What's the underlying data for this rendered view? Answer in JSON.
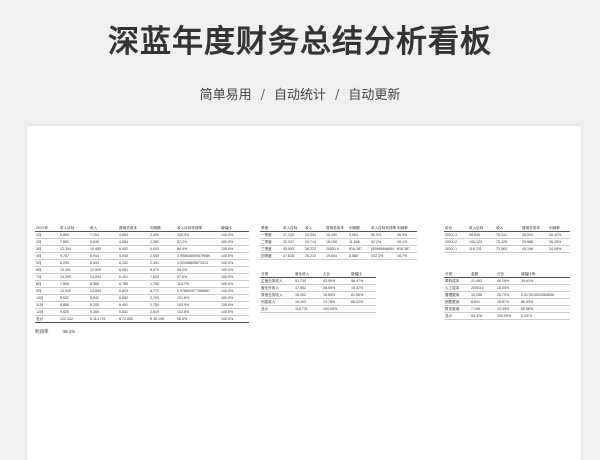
{
  "header": {
    "title": "深蓝年度财务总结分析看板",
    "tagline": [
      "简单易用",
      "自动统计",
      "自动更新"
    ],
    "separator": "/"
  },
  "monthly": {
    "headers": [
      "20XX年",
      "收入目标",
      "收入",
      "费用总成本",
      "利润额",
      "收入目标完成率",
      "增幅比"
    ],
    "rows": [
      [
        "1月",
        "9,883",
        "7,254",
        "4,854",
        "2,400",
        "105.4%",
        "100.0%"
      ],
      [
        "2月",
        "7,851",
        "6,845",
        "4,584",
        "2,261",
        "87.2%",
        "100.0%"
      ],
      [
        "3月",
        "12,394",
        "10,455",
        "6,052",
        "4,403",
        "84.4%",
        "100.0%"
      ],
      [
        "4月",
        "9,707",
        "8,944",
        "5,945",
        "2,599",
        "0.996608590579989",
        "100.0%"
      ],
      [
        "5月",
        "8,233",
        "8,643",
        "6,152",
        "2,491",
        "1.02408805673413",
        "100.0%"
      ],
      [
        "6月",
        "13,391",
        "12,525",
        "6,051",
        "6,574",
        "94.2%",
        "100.0%"
      ],
      [
        "7月",
        "14,399",
        "14,054",
        "6,451",
        "7,603",
        "97.6%",
        "100.0%"
      ],
      [
        "8月",
        "7,505",
        "8,585",
        "6,785",
        "1,780",
        "114.7%",
        "100.0%"
      ],
      [
        "9月",
        "13,949",
        "13,654",
        "6,823",
        "6,771",
        "0.978892977468867",
        "100.0%"
      ],
      [
        "10月",
        "8,632",
        "8,641",
        "6,652",
        "2,793",
        "101.6%",
        "100.0%"
      ],
      [
        "11月",
        "8,866",
        "6,205",
        "6,451",
        "2,754",
        "103.9%",
        "100.0%"
      ],
      [
        "12月",
        "9,520",
        "9,360",
        "6,541",
        "2,819",
        "102.6%",
        "100.0%"
      ]
    ],
    "total": [
      "总计",
      "122,342",
      "¥ 114,701",
      "¥ 72,555",
      "¥ 45,198",
      "96.8%",
      "100.0%"
    ]
  },
  "profit_rate": {
    "label": "利润率",
    "value": "39.1%"
  },
  "quarterly": {
    "headers": [
      "季度",
      "收入目标",
      "收入",
      "费用总成本",
      "利润额",
      "收入目标完成率",
      "利润率"
    ],
    "rows": [
      [
        "一季度",
        "27,130",
        "24,554",
        "15,490",
        "9,064",
        "90.5%",
        "36.9%"
      ],
      [
        "二季度",
        "32,247",
        "29,714",
        "18,108",
        "11,606",
        "92.2%",
        "39.1%"
      ],
      [
        "三季度",
        "35,553",
        "36,223",
        "20551.9",
        "¥16,387",
        "(50599646894",
        "¥16,387"
      ],
      [
        "四季度",
        "27,616",
        "26,210",
        "19,644",
        "8,566",
        "102.1%",
        "28.7%"
      ]
    ]
  },
  "yearly": {
    "headers": [
      "年份",
      "收入目标",
      "收入",
      "费用总成本",
      "利润率"
    ],
    "rows": [
      [
        "20XX-3",
        "98,545",
        "76,341",
        "28,004",
        "28.42%"
      ],
      [
        "20XX-2",
        "105,123",
        "75,425",
        "29,686",
        "26.25%"
      ],
      [
        "20XX-1",
        "118,701",
        "73,563",
        "45,198",
        "34.08%"
      ]
    ]
  },
  "income": {
    "headers": [
      "分类",
      "营业收入",
      "占比",
      "增幅比"
    ],
    "rows": [
      [
        "主营业务收入",
        "51,730",
        "43.55%",
        "56.47%"
      ],
      [
        "营业外收入",
        "37,552",
        "28.59%",
        "15.42%"
      ],
      [
        "其他业务收入",
        "18,052",
        "16.65%",
        "61.55%"
      ],
      [
        "利息收入",
        "16,303",
        "13.78%",
        "86.22%"
      ],
      [
        "总计",
        "118,701",
        "100.00%",
        ""
      ]
    ]
  },
  "expense": {
    "headers": [
      "分类",
      "金额",
      "占比",
      "增幅比例"
    ],
    "rows": [
      [
        "原料成本",
        "21,493",
        "40.19%",
        "39.61%"
      ],
      [
        "人工成本",
        "20003.0",
        "18.00%",
        ""
      ],
      [
        "管理费用",
        "10,256",
        "25.70%",
        "0.917813520964536"
      ],
      [
        "销售费用",
        "8,541",
        "15.97%",
        "80.03%"
      ],
      [
        "财务费用",
        "7,195",
        "13.44%",
        "85.56%"
      ],
      [
        "总计",
        "53,478",
        "100.00%",
        "5.1974"
      ]
    ]
  }
}
